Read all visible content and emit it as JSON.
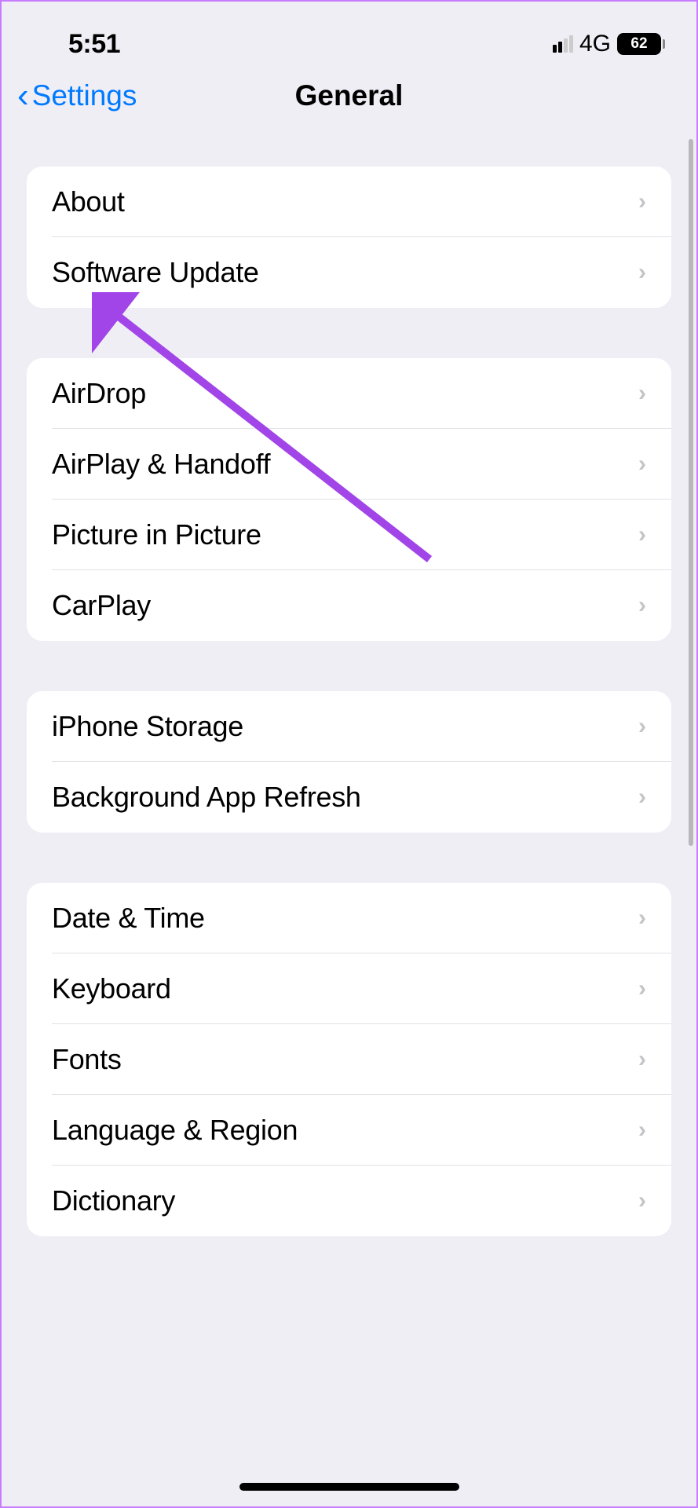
{
  "statusBar": {
    "time": "5:51",
    "network": "4G",
    "battery": "62"
  },
  "navBar": {
    "backLabel": "Settings",
    "title": "General"
  },
  "sections": [
    {
      "rows": [
        {
          "label": "About"
        },
        {
          "label": "Software Update"
        }
      ]
    },
    {
      "rows": [
        {
          "label": "AirDrop"
        },
        {
          "label": "AirPlay & Handoff"
        },
        {
          "label": "Picture in Picture"
        },
        {
          "label": "CarPlay"
        }
      ]
    },
    {
      "rows": [
        {
          "label": "iPhone Storage"
        },
        {
          "label": "Background App Refresh"
        }
      ]
    },
    {
      "rows": [
        {
          "label": "Date & Time"
        },
        {
          "label": "Keyboard"
        },
        {
          "label": "Fonts"
        },
        {
          "label": "Language & Region"
        },
        {
          "label": "Dictionary"
        }
      ]
    }
  ]
}
